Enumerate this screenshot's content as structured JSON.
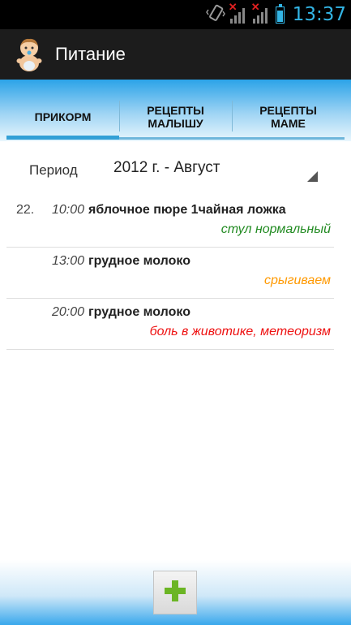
{
  "status_bar": {
    "time": "13:37",
    "icons": [
      "vibrate-icon",
      "signal-1-no-service-icon",
      "signal-2-no-service-icon",
      "battery-icon"
    ],
    "accent_color": "#33b5e5"
  },
  "action_bar": {
    "title": "Питание",
    "icon": "baby-icon",
    "background": "#1c1c1c"
  },
  "tabs": [
    {
      "line1": "ПРИКОРМ",
      "line2": "",
      "active": true
    },
    {
      "line1": "РЕЦЕПТЫ",
      "line2": "МАЛЫШУ",
      "active": false
    },
    {
      "line1": "РЕЦЕПТЫ",
      "line2": "МАМЕ",
      "active": false
    }
  ],
  "period": {
    "label": "Период",
    "value": "2012 г. - Август"
  },
  "entries": [
    {
      "day": "22.",
      "time": "10:00",
      "food": "яблочное пюре 1чайная ложка",
      "note": "стул нормальный",
      "note_color": "#228b22"
    },
    {
      "day": "",
      "time": "13:00",
      "food": "грудное молоко",
      "note": "срыгиваем",
      "note_color": "#ff9900"
    },
    {
      "day": "",
      "time": "20:00",
      "food": "грудное молоко",
      "note": "боль в животике, метеоризм",
      "note_color": "#ee1111"
    }
  ],
  "add_button": {
    "icon": "plus-icon",
    "color": "#6bb524"
  },
  "colors": {
    "tab_accent": "#33a0d6",
    "gradient_top": "#2ba3e8"
  }
}
